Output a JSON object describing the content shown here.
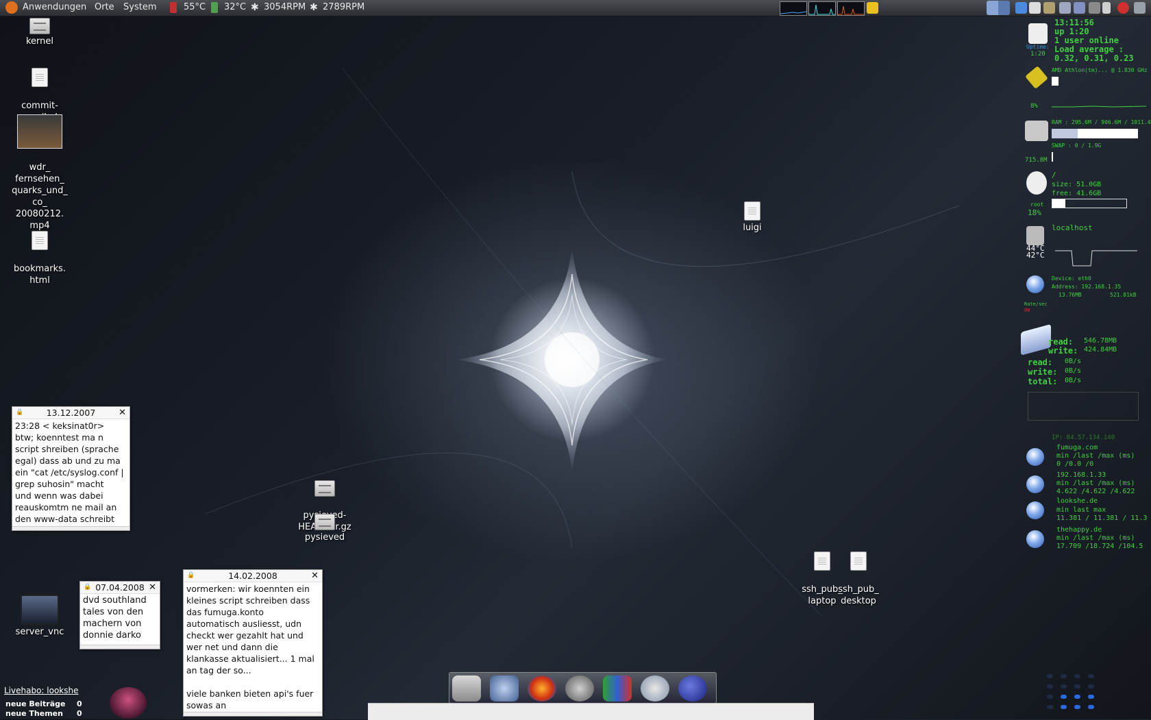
{
  "top_panel": {
    "menus": [
      "Anwendungen",
      "Orte",
      "System"
    ],
    "sensors": [
      {
        "icon": "thermometer-icon",
        "value": "55°C"
      },
      {
        "icon": "thermometer-icon",
        "value": "32°C"
      },
      {
        "icon": "fan-icon",
        "value": "3054RPM"
      },
      {
        "icon": "fan-icon",
        "value": "2789RPM"
      }
    ]
  },
  "desktop_icons": {
    "kernel": "kernel",
    "commit_email": "commit-\nemail.pl",
    "video": "wdr_\nfernsehen_\nquarks_und_\nco_\n20080212.\nmp4",
    "bookmarks": "bookmarks.\nhtml",
    "luigi": "luigi",
    "pysieved_head": "pysieved-\nHEAD.tar.gz",
    "pysieved": "pysieved",
    "ssh_laptop": "ssh_pub_\nlaptop",
    "ssh_desktop": "ssh_pub_\ndesktop",
    "server_vnc": "server_vnc"
  },
  "notes": [
    {
      "date": "13.12.2007",
      "text": "23:28 < keksinat0r>\nbtw; koenntest ma n\nscript shreiben (sprache\negal) dass ab und zu ma\nein \"cat /etc/syslog.conf |\ngrep suhosin\" macht\nund wenn was dabei\nreauskomtm ne mail an\nden www-data schreibt"
    },
    {
      "date": "07.04.2008",
      "text": "dvd southland\ntales von den\nmachern von\ndonnie darko"
    },
    {
      "date": "14.02.2008",
      "text": "vormerken: wir koennten ein\nkleines script schreiben dass\ndas fumuga.konto\nautomatisch ausliesst, udn\ncheckt wer gezahlt hat und\nwer net und dann die\nklankasse aktualisiert... 1 mal\nan tag der so...\n\nviele banken bieten api's fuer\nsowas an"
    }
  ],
  "conky": {
    "time": "13:11:56",
    "uptime": "up 1:20",
    "users": "1 user online",
    "load_label": "Load average :",
    "load": "0.32, 0.31, 0.23",
    "uptime_label": "Uptime:",
    "uptime_small": "1:20",
    "cpu_name": "AMD Athlon(tm)... @ 1.830 GHz",
    "cpu_pct": "8%",
    "cpu_fraction": 0.08,
    "ram": "RAM : 295.6M / 906.6M / 1011.4M",
    "ram_fraction": 0.3,
    "swap": "SWAP : 0 / 1.9G",
    "ram_free": "715.8M",
    "fs_mount": "/",
    "fs_size": "size: 51.0GB",
    "fs_free": "free: 41.6GB",
    "fs_fraction": 0.18,
    "fs_user": "root",
    "fs_pct": "18%",
    "host": "localhost",
    "temp1": "44°C",
    "temp2": "42°C",
    "net_device": "Device: eth0",
    "net_address": "Address: 192.168.1.35",
    "net_down": "13.76MB",
    "net_up": "521.81kB",
    "net_rate": "Rate/sec",
    "net_rate_val": "00",
    "disk_read_label": "read:",
    "disk_write_label": "write:",
    "disk_read": "546.78MB",
    "disk_write": "424.84MB",
    "rate_read": "0B/s",
    "rate_write": "0B/s",
    "total_label": "total:",
    "rate_total": "0B/s",
    "ip": "IP: 84.57.134.140",
    "pings": [
      {
        "host": "fumuga.com",
        "header": "min /last /max (ms)",
        "values": "0  /0.0  /0"
      },
      {
        "host": "192.168.1.33",
        "header": "min /last /max (ms)",
        "values": "4.622  /4.622  /4.622"
      },
      {
        "host": "lookshe.de",
        "header": "min      last      max",
        "values": "11.381  / 11.381  / 11.3"
      },
      {
        "host": "thehappy.de",
        "header": "min /last /max (ms)",
        "values": "17.709  /18.724  /104.5"
      }
    ]
  },
  "livehabo": {
    "title": "Livehabo: lookshe",
    "rows": [
      {
        "label": "neue Beiträge",
        "value": "0"
      },
      {
        "label": "neue Themen",
        "value": "0"
      }
    ]
  },
  "colors": {
    "conky_green": "#3ed33e",
    "panel": "#3a3c40",
    "desktop": "#1a1f28"
  }
}
